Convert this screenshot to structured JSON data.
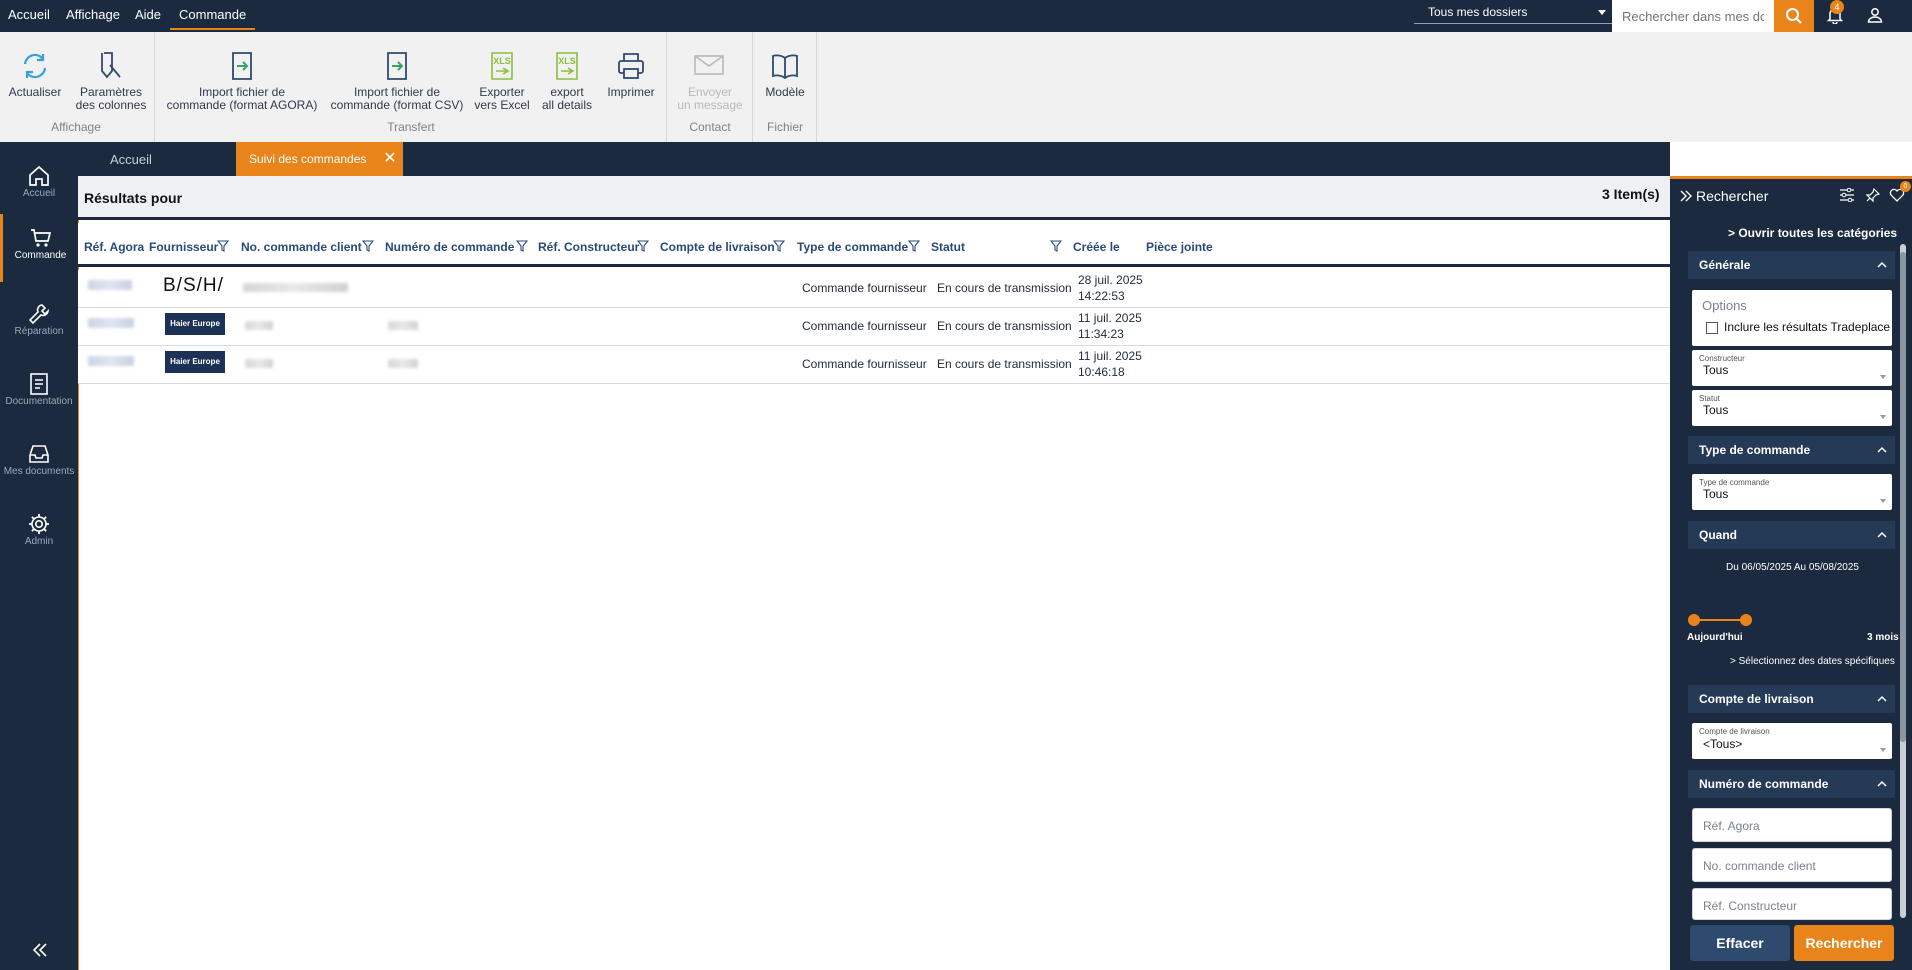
{
  "menu": {
    "items": [
      "Accueil",
      "Affichage",
      "Aide",
      "Commande"
    ],
    "active": "Commande"
  },
  "topbar": {
    "folder_select": "Tous mes dossiers",
    "search_placeholder": "Rechercher dans mes dossiers",
    "notif_count": "4"
  },
  "ribbon": {
    "buttons": [
      {
        "l1": "Actualiser",
        "l2": ""
      },
      {
        "l1": "Paramètres",
        "l2": "des colonnes"
      },
      {
        "l1": "Import fichier de",
        "l2": "commande (format AGORA)"
      },
      {
        "l1": "Import fichier de",
        "l2": "commande (format CSV)"
      },
      {
        "l1": "Exporter",
        "l2": "vers Excel"
      },
      {
        "l1": "export",
        "l2": "all details"
      },
      {
        "l1": "Imprimer",
        "l2": ""
      },
      {
        "l1": "Envoyer",
        "l2": "un message"
      },
      {
        "l1": "Modèle",
        "l2": ""
      }
    ],
    "groups": [
      "Affichage",
      "Transfert",
      "Contact",
      "Fichier"
    ],
    "xls_label": "XLS"
  },
  "nav": {
    "items": [
      "Accueil",
      "Commande",
      "Réparation",
      "Documentation",
      "Mes documents",
      "Admin"
    ],
    "active": "Commande"
  },
  "tabs": {
    "home": "Accueil",
    "active": "Suivi des commandes",
    "close": "✕"
  },
  "results": {
    "title": "Résultats pour",
    "count": "3 Item(s)"
  },
  "table": {
    "columns": [
      "Réf. Agora",
      "Fournisseur",
      "No. commande client",
      "Numéro de commande",
      "Réf. Constructeur",
      "Compte de livraison",
      "Type de commande",
      "Statut",
      "Créée le",
      "Pièce jointe"
    ],
    "rows": [
      {
        "supplier": "B/S/H/",
        "type": "Commande fournisseur",
        "status": "En cours de transmission",
        "date": "28 juil. 2025",
        "time": "14:22:53"
      },
      {
        "supplier": "Haier Europe",
        "type": "Commande fournisseur",
        "status": "En cours de transmission",
        "date": "11 juil. 2025",
        "time": "11:34:23"
      },
      {
        "supplier": "Haier Europe",
        "type": "Commande fournisseur",
        "status": "En cours de transmission",
        "date": "11 juil. 2025",
        "time": "10:46:18"
      }
    ]
  },
  "search_panel": {
    "title": "Rechercher",
    "fav_count": "0",
    "open_all": "> Ouvrir toutes les catégories",
    "sections": {
      "generale": "Générale",
      "type": "Type de commande",
      "quand": "Quand",
      "compte": "Compte de livraison",
      "numero": "Numéro de commande"
    },
    "options_label": "Options",
    "tradeplace": "Inclure les résultats Tradeplace",
    "constructeur": {
      "label": "Constructeur",
      "value": "Tous"
    },
    "statut": {
      "label": "Statut",
      "value": "Tous"
    },
    "type_commande": {
      "label": "Type de commande",
      "value": "Tous"
    },
    "date_range": "Du 06/05/2025 Au 05/08/2025",
    "slider": {
      "min_label": "Aujourd'hui",
      "max_label": "3 mois",
      "value": 1
    },
    "specific_dates": "> Sélectionnez des dates spécifiques",
    "compte_livraison": {
      "label": "Compte de livraison",
      "value": "<Tous>"
    },
    "inputs": {
      "ref_agora": "Réf. Agora",
      "no_cmd_client": "No. commande client",
      "ref_constructeur": "Réf. Constructeur"
    },
    "btn_clear": "Effacer",
    "btn_search": "Rechercher"
  },
  "colors": {
    "navy": "#1b2a3f",
    "accent": "#e8841a"
  }
}
